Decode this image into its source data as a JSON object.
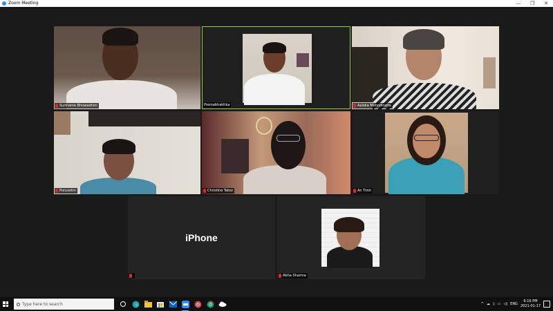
{
  "window": {
    "title": "Zoom Meeting",
    "minimize": "—",
    "maximize": "❐",
    "close": "✕"
  },
  "participants": [
    {
      "name": "Suriname Bhowadhini",
      "muted": true
    },
    {
      "name": "Premabhaktika",
      "muted": false,
      "active": true
    },
    {
      "name": "Aaloka Mehndiratta",
      "muted": true
    },
    {
      "name": "Purusotm",
      "muted": true
    },
    {
      "name": "Christine Tabor",
      "muted": true
    },
    {
      "name": "An Trinh",
      "muted": true
    },
    {
      "name": "",
      "muted": true,
      "video_label": "iPhone"
    },
    {
      "name": "Abha Sharma",
      "muted": true
    }
  ],
  "taskbar": {
    "search_placeholder": "Type here to search",
    "apps": [
      "task-view",
      "edge",
      "file-explorer",
      "store",
      "mail",
      "zoom",
      "chrome-alt",
      "chrome",
      "onedrive"
    ],
    "tray_lang": "ENG",
    "time": "6:16 PM",
    "date": "2021-01-17"
  },
  "colors": {
    "active_border": "#9acd32",
    "muted_mic": "#e02828",
    "zoom_blue": "#2d8cff",
    "stage_bg": "#1a1a1a"
  }
}
